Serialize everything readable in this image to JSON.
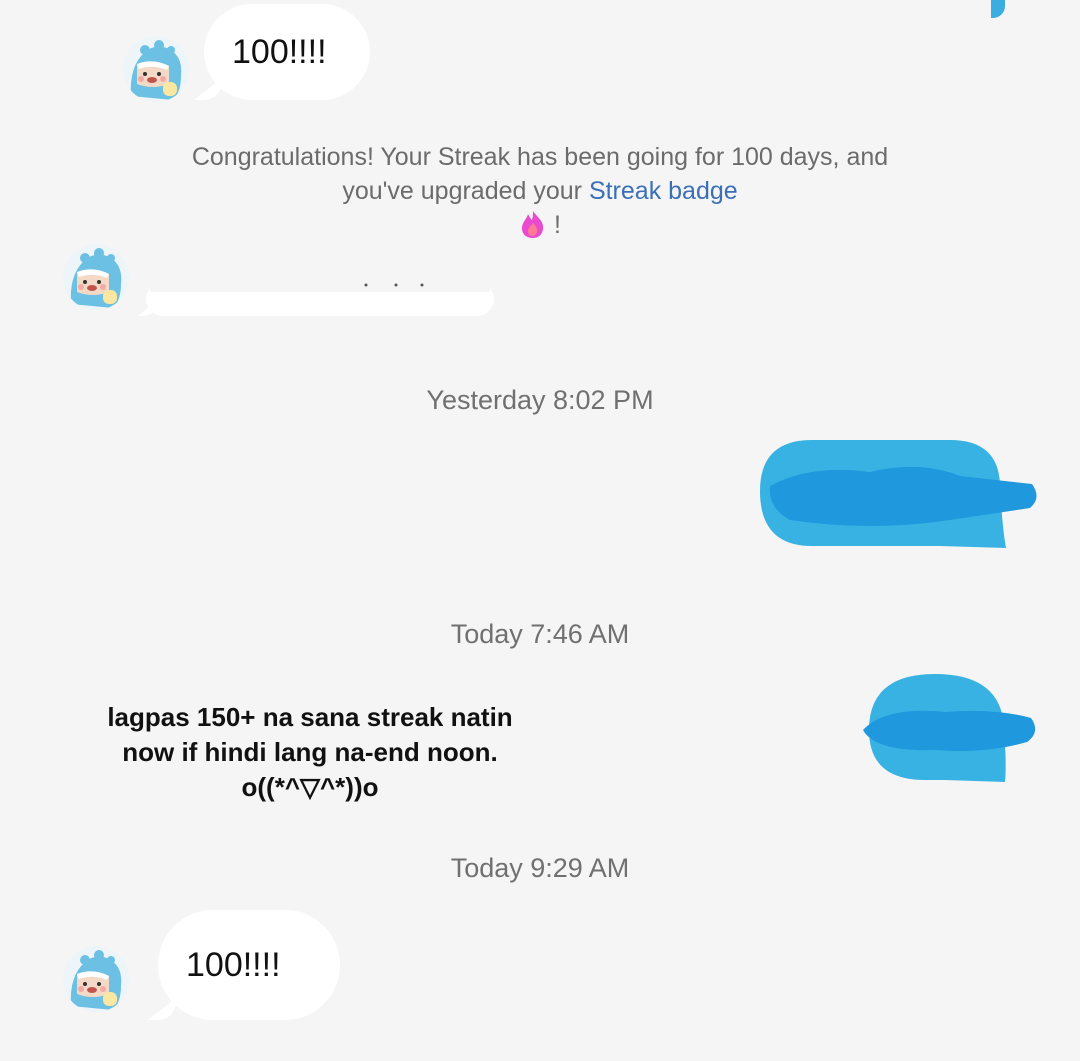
{
  "messages": {
    "first": {
      "text": "100!!!!"
    },
    "streak_notice": {
      "text_before": "Congratulations! Your Streak has been going for 100 days, and you've upgraded your ",
      "link": "Streak badge",
      "text_after": "!"
    },
    "last": {
      "text": "100!!!!"
    }
  },
  "timestamps": {
    "yesterday": "Yesterday 8:02 PM",
    "today_morning": "Today 7:46 AM",
    "today_late": "Today 9:29 AM"
  },
  "overlay_caption": {
    "line1": "lagpas 150+ na sana streak natin",
    "line2": "now if hindi lang na-end noon.",
    "line3": "o((*^▽^*))o"
  },
  "colors": {
    "background": "#f5f5f6",
    "outgoing_bubble": "#38b2e2",
    "redaction": "#1f98de",
    "link": "#3b6fb6",
    "flame": "#e94bd0"
  },
  "icons": {
    "avatar": "dino-avatar-icon",
    "streak": "flame-icon"
  }
}
